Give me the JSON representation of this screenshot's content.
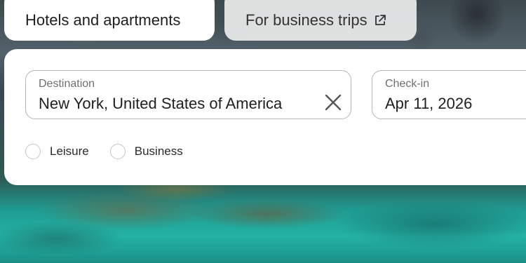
{
  "tabs": {
    "hotels_label": "Hotels and apartments",
    "business_label": "For business trips",
    "business_icon": "external-link-icon"
  },
  "search": {
    "destination": {
      "label": "Destination",
      "value": "New York, United States of America",
      "clear_icon": "close-icon"
    },
    "checkin": {
      "label": "Check-in",
      "value": "Apr 11, 2026"
    }
  },
  "trip_type": {
    "options": [
      "Leisure",
      "Business"
    ]
  }
}
